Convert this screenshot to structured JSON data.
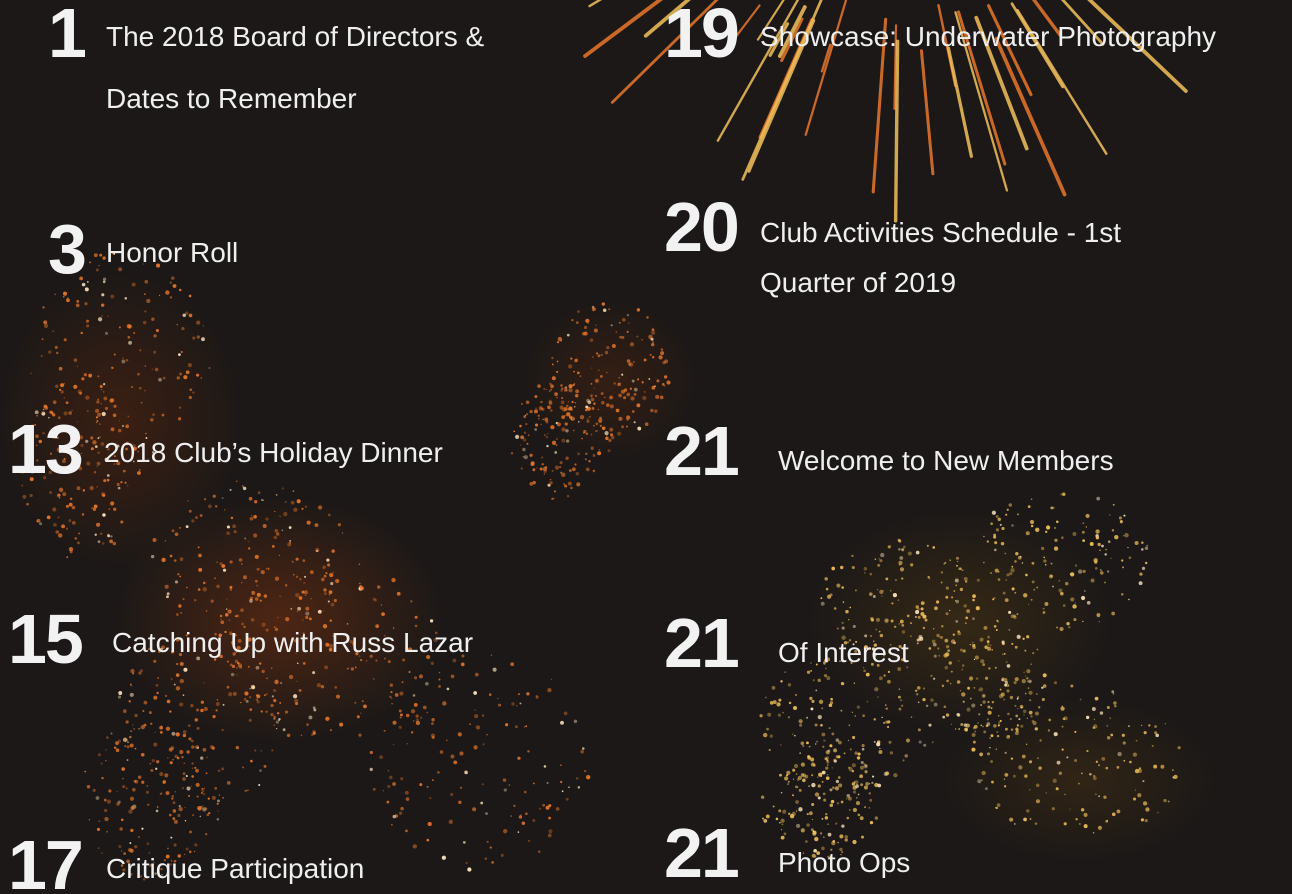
{
  "toc": {
    "left": [
      {
        "page": "1",
        "title": "The 2018 Board of Directors & Dates to Remember"
      },
      {
        "page": "3",
        "title": "Honor Roll"
      },
      {
        "page": "13",
        "title": "2018 Club’s Holiday Dinner"
      },
      {
        "page": "15",
        "title": "Catching Up with Russ Lazar"
      },
      {
        "page": "17",
        "title": "Critique Participation"
      }
    ],
    "right": [
      {
        "page": "19",
        "title": "Showcase: Underwater Photography"
      },
      {
        "page": "20",
        "title": "Club Activities Schedule - 1st Quarter of 2019"
      },
      {
        "page": "21",
        "title": "Welcome to New Members"
      },
      {
        "page": "21",
        "title": "Of Interest"
      },
      {
        "page": "21",
        "title": "Photo Ops"
      }
    ]
  },
  "colors": {
    "background": "#1b1817",
    "text": "#efefef",
    "spark_orange": "#e8772a",
    "spark_gold": "#f2c15a"
  }
}
